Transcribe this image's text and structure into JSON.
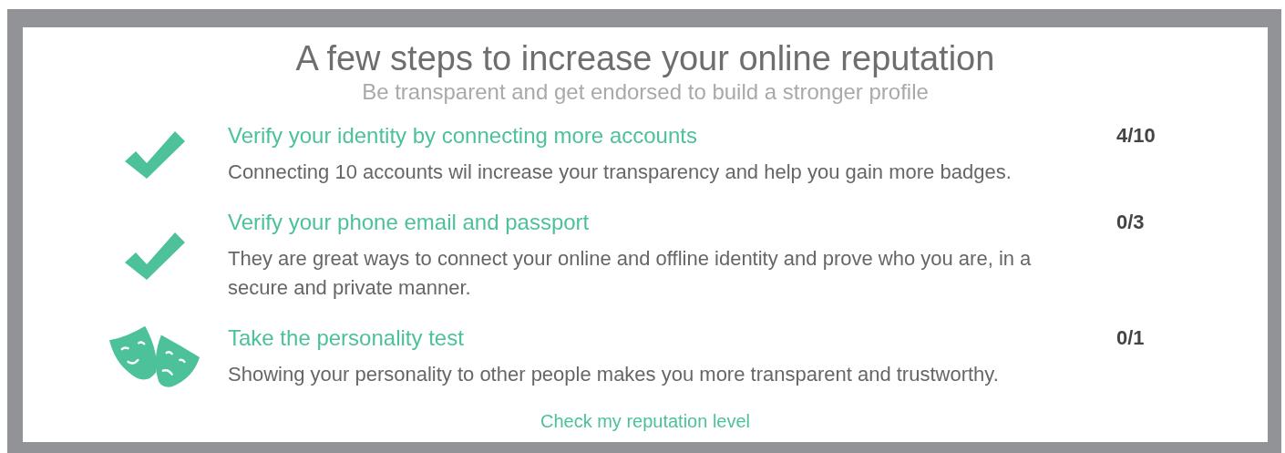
{
  "title": "A few steps to increase your online reputation",
  "subtitle": "Be transparent and get endorsed to build a stronger profile",
  "steps": [
    {
      "kind": "check",
      "title": "Verify your identity by connecting more accounts",
      "description": "Connecting 10 accounts wil increase your transparency and help you gain more badges.",
      "count": "4/10"
    },
    {
      "kind": "check",
      "title": "Verify your phone email and passport",
      "description": "They are great ways to connect your online and offline identity and prove who you are, in a secure and private manner.",
      "count": "0/3"
    },
    {
      "kind": "masks",
      "title": "Take the personality test",
      "description": "Showing your personality to other people makes you more transparent and trustworthy.",
      "count": "0/1"
    }
  ],
  "link": "Check my reputation level"
}
